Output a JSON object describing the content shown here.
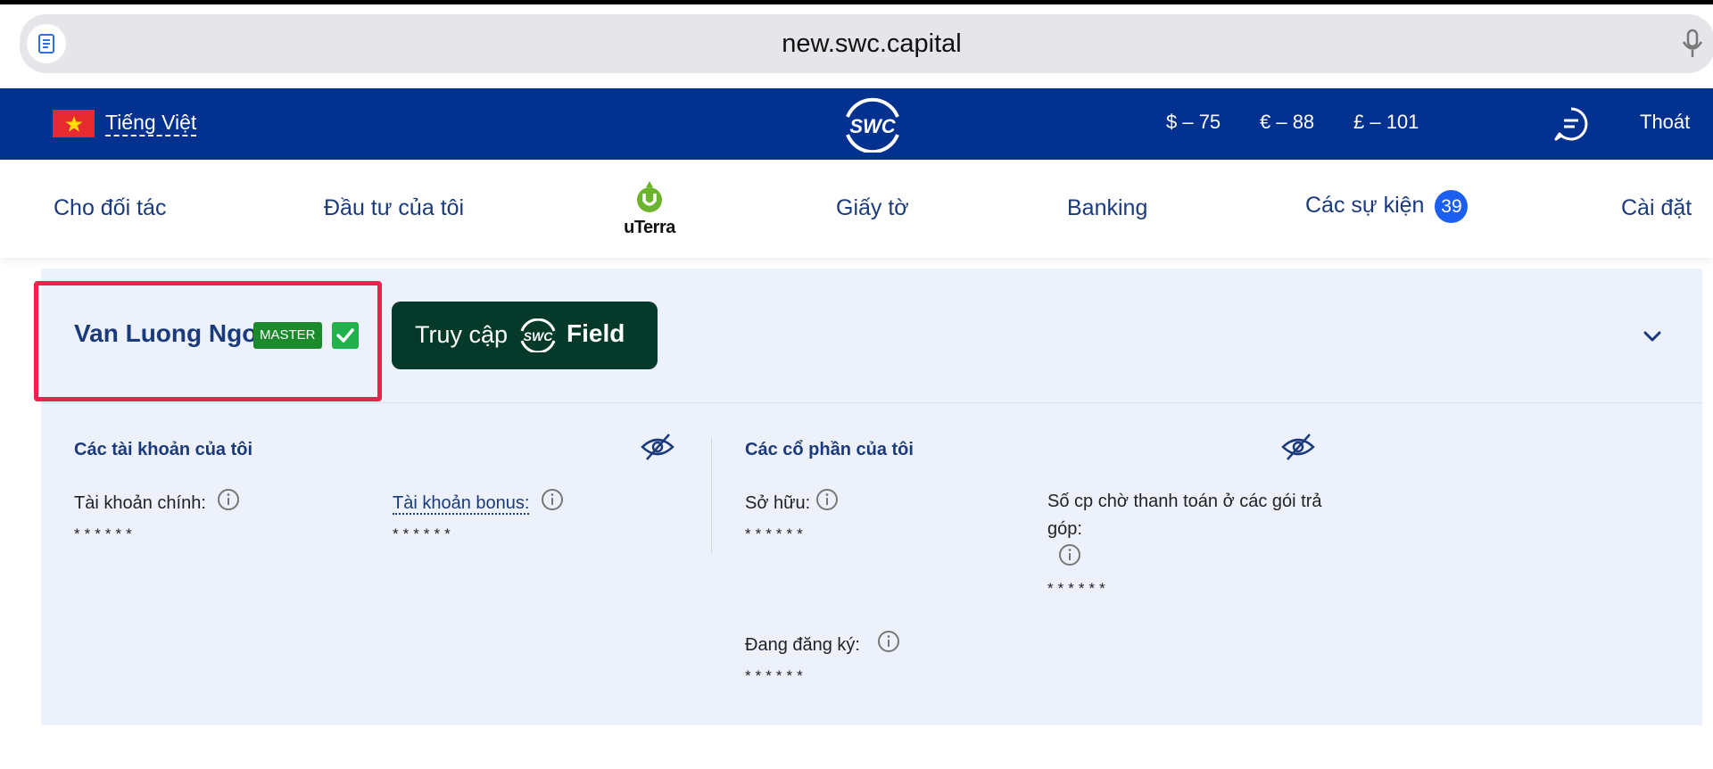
{
  "browser": {
    "url": "new.swc.capital"
  },
  "header": {
    "language": "Tiếng Việt",
    "logo_text": "SWC",
    "rates": [
      "$ – 75",
      "€ – 88",
      "£ – 101"
    ],
    "logout": "Thoát"
  },
  "nav": {
    "items": [
      "Cho đối tác",
      "Đầu tư của tôi",
      "Giấy tờ",
      "Banking",
      "Các sự kiện",
      "Cài đặt"
    ],
    "uterra": "uTerra",
    "events_count": "39"
  },
  "profile": {
    "name": "Van Luong Ngo",
    "badge": "MASTER",
    "field_button": {
      "prefix": "Truy cập",
      "logo": "SWC",
      "suffix": "Field"
    }
  },
  "accounts": {
    "title": "Các tài khoản của tôi",
    "main_label": "Tài khoản chính:",
    "main_value": "******",
    "bonus_label": "Tài khoản bonus:",
    "bonus_value": "******"
  },
  "shares": {
    "title": "Các cổ phần của tôi",
    "owned_label": "Sở hữu:",
    "owned_value": "******",
    "pending_label": "Số cp chờ thanh toán ở các gói trả góp:",
    "pending_value": "******",
    "registering_label": "Đang đăng ký:",
    "registering_value": "******"
  },
  "colors": {
    "header_blue": "#02318f",
    "nav_text": "#1b3a7a",
    "panel_bg": "#ecf1fb",
    "highlight": "#f0204d",
    "field_button": "#053a2a",
    "master_badge": "#1b8a2c",
    "events_badge": "#1a5ff0"
  },
  "icons": [
    "reader-icon",
    "microphone-icon",
    "vietnam-flag-icon",
    "swc-logo-icon",
    "chat-icon",
    "uterra-logo-icon",
    "verified-check-icon",
    "chevron-down-icon",
    "eye-slash-icon",
    "info-icon"
  ]
}
